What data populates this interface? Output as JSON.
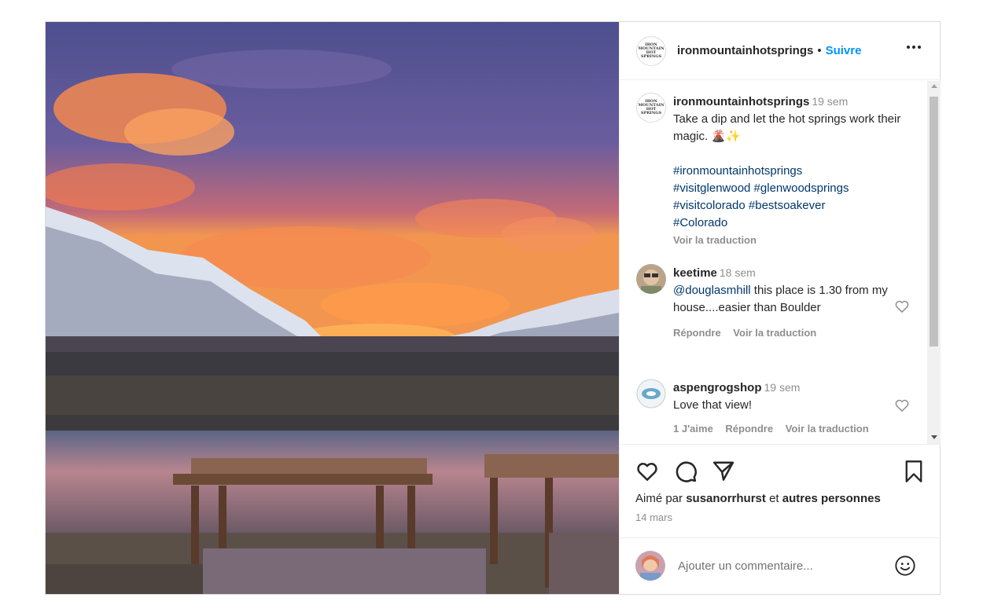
{
  "post": {
    "username": "ironmountainhotsprings",
    "dot": "•",
    "follow_label": "Suivre",
    "more_label": "•••",
    "logo_text": "IRON MOUNTAIN HOT SPRINGS"
  },
  "caption": {
    "username": "ironmountainhotsprings",
    "time": "19 sem",
    "text": "Take a dip and let the hot springs work their magic. 🌋✨",
    "hashtags_line1": "#ironmountainhotsprings",
    "hashtags_line2": "#visitglenwood #glenwoodsprings",
    "hashtags_line3": "#visitcolorado #bestsoakever",
    "hashtags_line4": "#Colorado",
    "translate": "Voir la traduction"
  },
  "comments": [
    {
      "username": "keetime",
      "time": "18 sem",
      "mention": "@douglasmhill",
      "text": " this place is 1.30 from my house....easier than Boulder",
      "reply": "Répondre",
      "translate": "Voir la traduction"
    },
    {
      "username": "aspengrogshop",
      "time": "19 sem",
      "text": "Love that view!",
      "likes": "1 J'aime",
      "reply": "Répondre",
      "translate": "Voir la traduction"
    }
  ],
  "actions": {
    "liked_prefix": "Aimé par ",
    "liked_user": "susanorrhurst",
    "liked_mid": " et ",
    "liked_others": "autres personnes",
    "date": "14 mars"
  },
  "add_comment": {
    "placeholder": "Ajouter un commentaire..."
  },
  "icons": [
    "like-icon",
    "comment-icon",
    "share-icon",
    "save-icon",
    "more-icon",
    "emoji-icon",
    "heart-small-icon"
  ],
  "colors": {
    "link": "#0095f6",
    "hashtag": "#00376b",
    "muted": "#8e8e8e"
  }
}
